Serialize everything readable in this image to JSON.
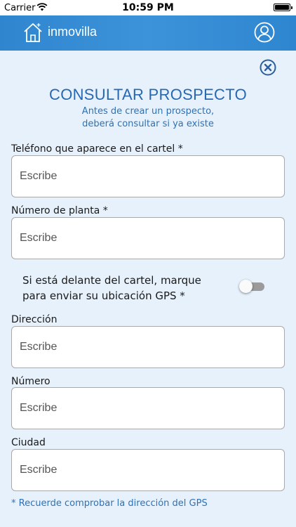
{
  "status_bar": {
    "carrier": "Carrier",
    "time": "10:59 PM"
  },
  "header": {
    "logo_text": "inmovilla",
    "background_color": "#3b8fd5"
  },
  "form": {
    "title": "CONSULTAR PROSPECTO",
    "subtitle_line1": "Antes de crear un prospecto,",
    "subtitle_line2": "deberá consultar si ya existe",
    "fields": [
      {
        "label": "Teléfono que aparece en el cartel *",
        "placeholder": "Escribe",
        "value": ""
      },
      {
        "label": "Número de planta *",
        "placeholder": "Escribe",
        "value": ""
      },
      {
        "label": "Dirección",
        "placeholder": "Escribe",
        "value": ""
      },
      {
        "label": "Número",
        "placeholder": "Escribe",
        "value": ""
      },
      {
        "label": "Ciudad",
        "placeholder": "Escribe",
        "value": ""
      }
    ],
    "gps": {
      "label_line1": "Si está delante del cartel, marque",
      "label_line2": "para enviar su ubicación GPS *",
      "enabled": false
    },
    "footer_note": "* Recuerde comprobar la dirección del GPS"
  },
  "colors": {
    "accent": "#2868b1",
    "page_background": "#e6f1fb"
  },
  "icons": {
    "logo": "house-icon",
    "user": "user-icon",
    "close": "close-icon",
    "wifi": "wifi-icon",
    "battery": "battery-icon"
  }
}
